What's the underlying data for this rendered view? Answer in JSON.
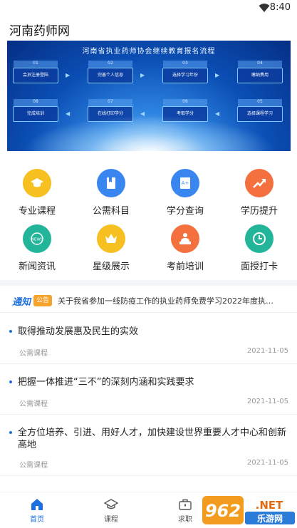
{
  "status": {
    "time": "8:40"
  },
  "header": {
    "title": "河南药师网"
  },
  "banner": {
    "title": "河南省执业药师协会继续教育报名流程",
    "steps": [
      {
        "num": "01",
        "label": "会员注册登陆"
      },
      {
        "num": "02",
        "label": "完善个人信息"
      },
      {
        "num": "03",
        "label": "选择学习年份"
      },
      {
        "num": "04",
        "label": "缴纳费用"
      },
      {
        "num": "08",
        "label": "完成培训"
      },
      {
        "num": "07",
        "label": "在线打印学分"
      },
      {
        "num": "06",
        "label": "考取学分"
      },
      {
        "num": "05",
        "label": "选择课程学习"
      }
    ]
  },
  "menu": [
    {
      "label": "专业课程",
      "icon": "graduation-cap-icon",
      "color": "#f5c020"
    },
    {
      "label": "公需科目",
      "icon": "book-icon",
      "color": "#3a86f0"
    },
    {
      "label": "学分查询",
      "icon": "grade-book-icon",
      "color": "#3a86f0"
    },
    {
      "label": "学历提升",
      "icon": "trend-up-icon",
      "color": "#f4713f"
    },
    {
      "label": "新闻资讯",
      "icon": "news-icon",
      "color": "#22b59a"
    },
    {
      "label": "星级展示",
      "icon": "crown-icon",
      "color": "#f5c020"
    },
    {
      "label": "考前培训",
      "icon": "presenter-icon",
      "color": "#f4713f"
    },
    {
      "label": "面授打卡",
      "icon": "clock-icon",
      "color": "#22b59a"
    }
  ],
  "notice": {
    "brand": "通知",
    "badge": "公告",
    "text": "关于我省参加一线防疫工作的执业药师免费学习2022年度执业药师..."
  },
  "news": [
    {
      "title": "取得推动发展惠及民生的实效",
      "tag": "公需课程",
      "date": "2021-11-05"
    },
    {
      "title": "把握一体推进“三不”的深刻内涵和实践要求",
      "tag": "公需课程",
      "date": "2021-11-05"
    },
    {
      "title": "全方位培养、引进、用好人才，加快建设世界重要人才中心和创新高地",
      "tag": "公需课程",
      "date": "2021-11-05"
    }
  ],
  "tabs": [
    {
      "label": "首页",
      "icon": "home-icon",
      "active": true
    },
    {
      "label": "课程",
      "icon": "graduation-cap-outline-icon"
    },
    {
      "label": "求职",
      "icon": "briefcase-icon"
    },
    {
      "label": "",
      "icon": ""
    }
  ],
  "watermark": {
    "text": "962.NET 乐游网"
  },
  "colors": {
    "accent": "#1e6fe0",
    "badge": "#f6a22b"
  }
}
